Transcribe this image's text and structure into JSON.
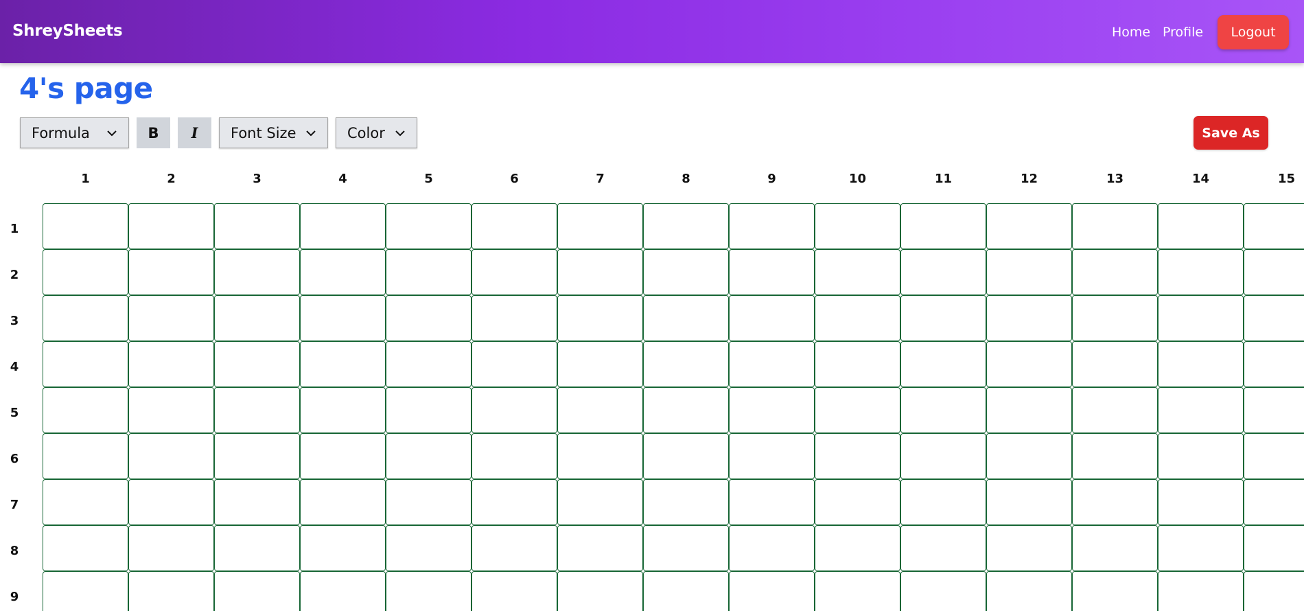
{
  "navbar": {
    "brand": "ShreySheets",
    "links": {
      "home": "Home",
      "profile": "Profile"
    },
    "logout_label": "Logout",
    "accent_color": "#9333ea",
    "logout_color": "#ef4444"
  },
  "page": {
    "title": "4's page",
    "title_color": "#2563eb"
  },
  "toolbar": {
    "formula_label": "Formula",
    "bold_label": "B",
    "italic_label": "I",
    "font_size_label": "Font Size",
    "color_label": "Color",
    "save_as_label": "Save As",
    "dropdown_icon": "chevron-down-icon"
  },
  "sheet": {
    "columns": [
      "1",
      "2",
      "3",
      "4",
      "5",
      "6",
      "7",
      "8",
      "9",
      "10",
      "11",
      "12",
      "13",
      "14",
      "15"
    ],
    "rows": [
      "1",
      "2",
      "3",
      "4",
      "5",
      "6",
      "7",
      "8",
      "9"
    ],
    "cell_border_color": "#166534"
  }
}
